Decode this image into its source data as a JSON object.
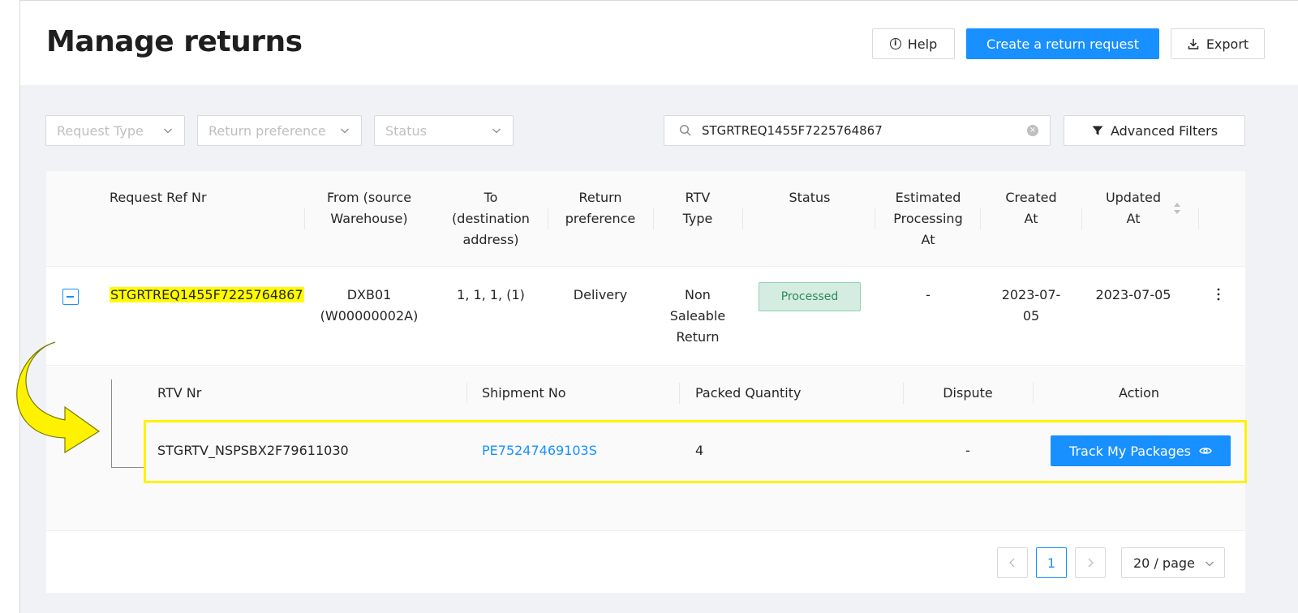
{
  "header": {
    "title": "Manage returns",
    "help_label": "Help",
    "create_label": "Create a return request",
    "export_label": "Export"
  },
  "filters": {
    "request_type_placeholder": "Request Type",
    "return_preference_placeholder": "Return preference",
    "status_placeholder": "Status",
    "search_value": "STGRTREQ1455F7225764867",
    "advanced_filters_label": "Advanced Filters"
  },
  "table": {
    "columns": {
      "ref": "Request Ref Nr",
      "from_1": "From (source",
      "from_2": "Warehouse)",
      "to_1": "To",
      "to_2": "(destination",
      "to_3": "address)",
      "pref_1": "Return",
      "pref_2": "preference",
      "rtv_1": "RTV",
      "rtv_2": "Type",
      "status": "Status",
      "est_1": "Estimated",
      "est_2": "Processing",
      "est_3": "At",
      "created_1": "Created",
      "created_2": "At",
      "updated_1": "Updated",
      "updated_2": "At"
    },
    "row": {
      "ref": "STGRTREQ1455F7225764867",
      "from_1": "DXB01",
      "from_2": "(W00000002A)",
      "to": "1, 1, 1, (1)",
      "pref": "Delivery",
      "rtv_1": "Non",
      "rtv_2": "Saleable",
      "rtv_3": "Return",
      "status": "Processed",
      "est": "-",
      "created_1": "2023-07-",
      "created_2": "05",
      "updated": "2023-07-05"
    },
    "sub_columns": {
      "rtv_nr": "RTV Nr",
      "shipment_no": "Shipment No",
      "packed_qty": "Packed Quantity",
      "dispute": "Dispute",
      "action": "Action"
    },
    "sub_row": {
      "rtv_nr": "STGRTV_NSPSBX2F79611030",
      "shipment_no": "PE75247469103S",
      "packed_qty": "4",
      "dispute": "-",
      "action_label": "Track My Packages"
    }
  },
  "pagination": {
    "current_page": "1",
    "page_size": "20 / page"
  },
  "colors": {
    "primary": "#1890ff",
    "highlight": "#fffb00",
    "status_bg": "#d5ece2",
    "status_text": "#2b8a5b"
  },
  "icons": [
    "info-icon",
    "download-icon",
    "chevron-down-icon",
    "search-icon",
    "clear-icon",
    "filter-icon",
    "collapse-icon",
    "more-vertical-icon",
    "eye-icon",
    "chevron-left-icon",
    "chevron-right-icon",
    "sort-icon",
    "curved-arrow-icon"
  ]
}
